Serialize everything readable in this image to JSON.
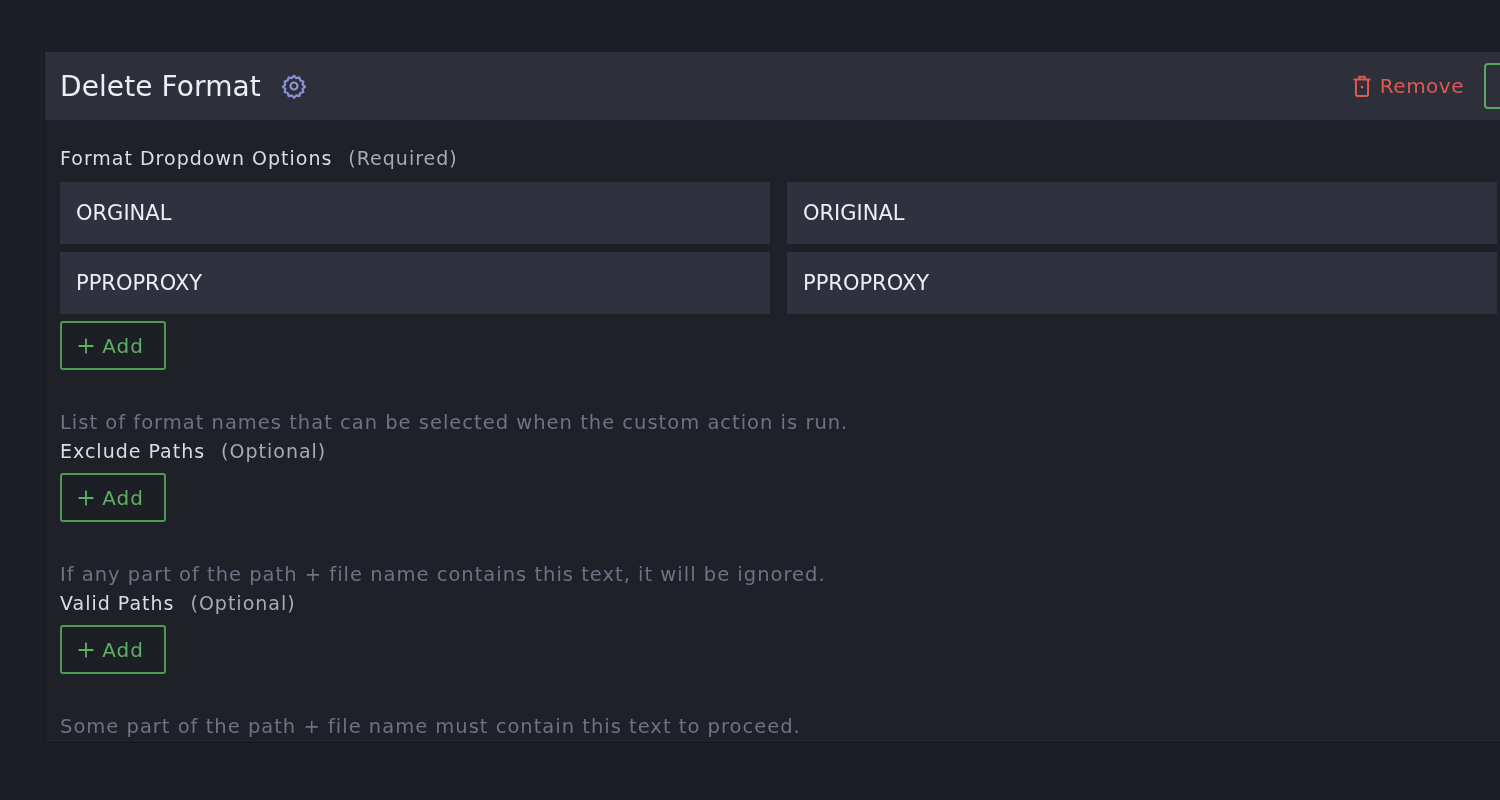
{
  "panel": {
    "title": "Delete Format",
    "remove_button": "Remove",
    "fields": [
      {
        "label": "Format Dropdown Options",
        "requirement": "(Required)",
        "rows": [
          {
            "key": "ORGINAL",
            "value": "ORIGINAL"
          },
          {
            "key": "PPROPROXY",
            "value": "PPROPROXY"
          }
        ],
        "add_button": "Add",
        "help": "List of format names that can be selected when the custom action is run."
      },
      {
        "label": "Exclude Paths",
        "requirement": "(Optional)",
        "add_button": "Add",
        "help": "If any part of the path + file name contains this text, it will be ignored."
      },
      {
        "label": "Valid Paths",
        "requirement": "(Optional)",
        "add_button": "Add",
        "help": "Some part of the path + file name must contain this text to proceed."
      }
    ]
  }
}
